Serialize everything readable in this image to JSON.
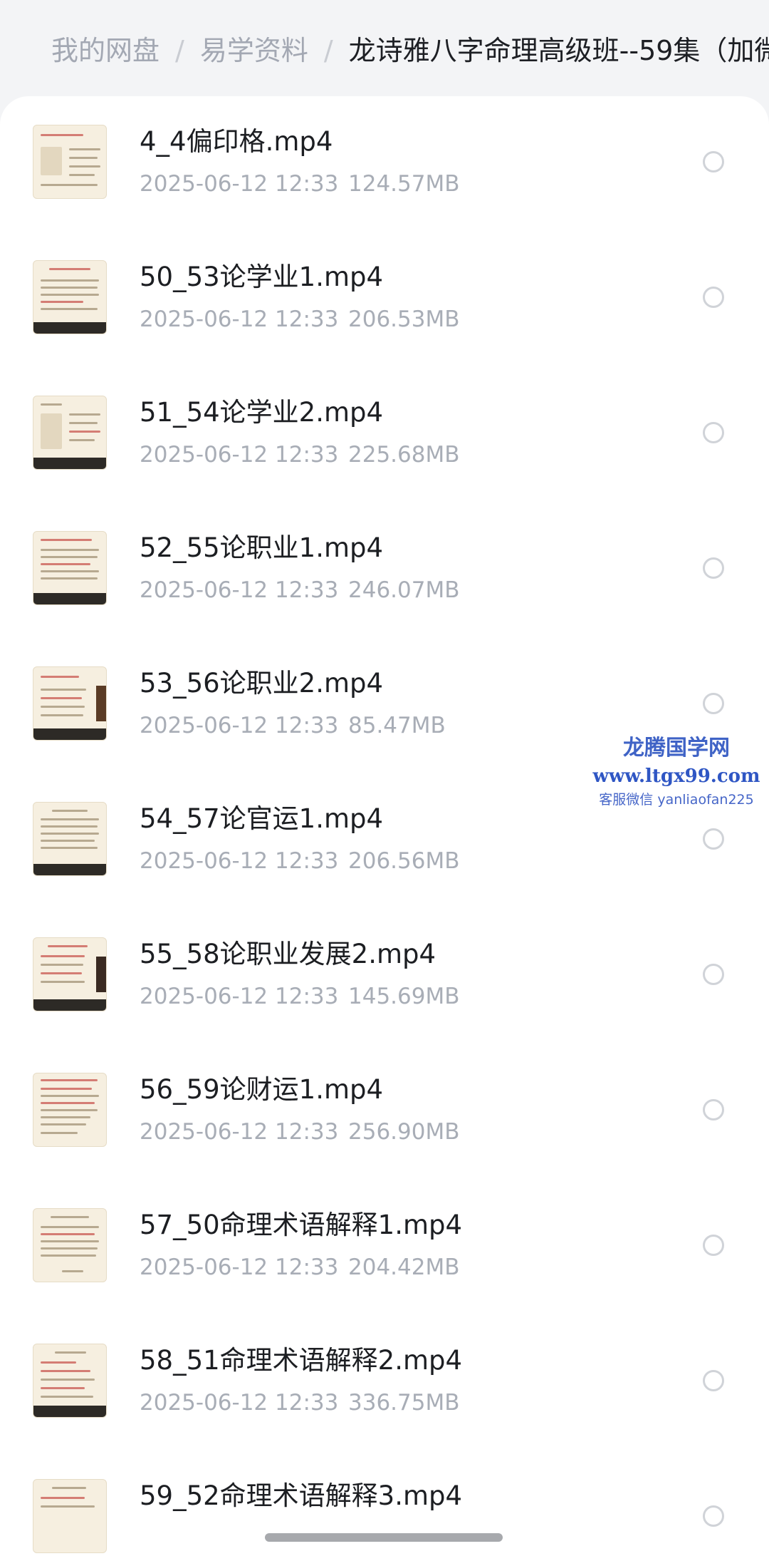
{
  "breadcrumb": [
    {
      "label": "我的网盘"
    },
    {
      "label": "易学资料"
    }
  ],
  "breadcrumb_current": "龙诗雅八字命理高级班--59集（加微",
  "breadcrumb_separator": "/",
  "files": [
    {
      "name": "4_4偏印格.mp4",
      "date": "2025-06-12  12:33",
      "size": "124.57MB"
    },
    {
      "name": "50_53论学业1.mp4",
      "date": "2025-06-12  12:33",
      "size": "206.53MB"
    },
    {
      "name": "51_54论学业2.mp4",
      "date": "2025-06-12  12:33",
      "size": "225.68MB"
    },
    {
      "name": "52_55论职业1.mp4",
      "date": "2025-06-12  12:33",
      "size": "246.07MB"
    },
    {
      "name": "53_56论职业2.mp4",
      "date": "2025-06-12  12:33",
      "size": "85.47MB"
    },
    {
      "name": "54_57论官运1.mp4",
      "date": "2025-06-12  12:33",
      "size": "206.56MB"
    },
    {
      "name": "55_58论职业发展2.mp4",
      "date": "2025-06-12  12:33",
      "size": "145.69MB"
    },
    {
      "name": "56_59论财运1.mp4",
      "date": "2025-06-12  12:33",
      "size": "256.90MB"
    },
    {
      "name": "57_50命理术语解释1.mp4",
      "date": "2025-06-12  12:33",
      "size": "204.42MB"
    },
    {
      "name": "58_51命理术语解释2.mp4",
      "date": "2025-06-12  12:33",
      "size": "336.75MB"
    },
    {
      "name": "59_52命理术语解释3.mp4",
      "date": "",
      "size": ""
    }
  ],
  "watermark": {
    "title": "龙腾国学网",
    "url": "www.ltgx99.com",
    "contact": "客服微信 yanliaofan225"
  },
  "colors": {
    "accent": "#3f63c6",
    "text_primary": "#1c1e22",
    "text_secondary": "#a8adb6"
  }
}
